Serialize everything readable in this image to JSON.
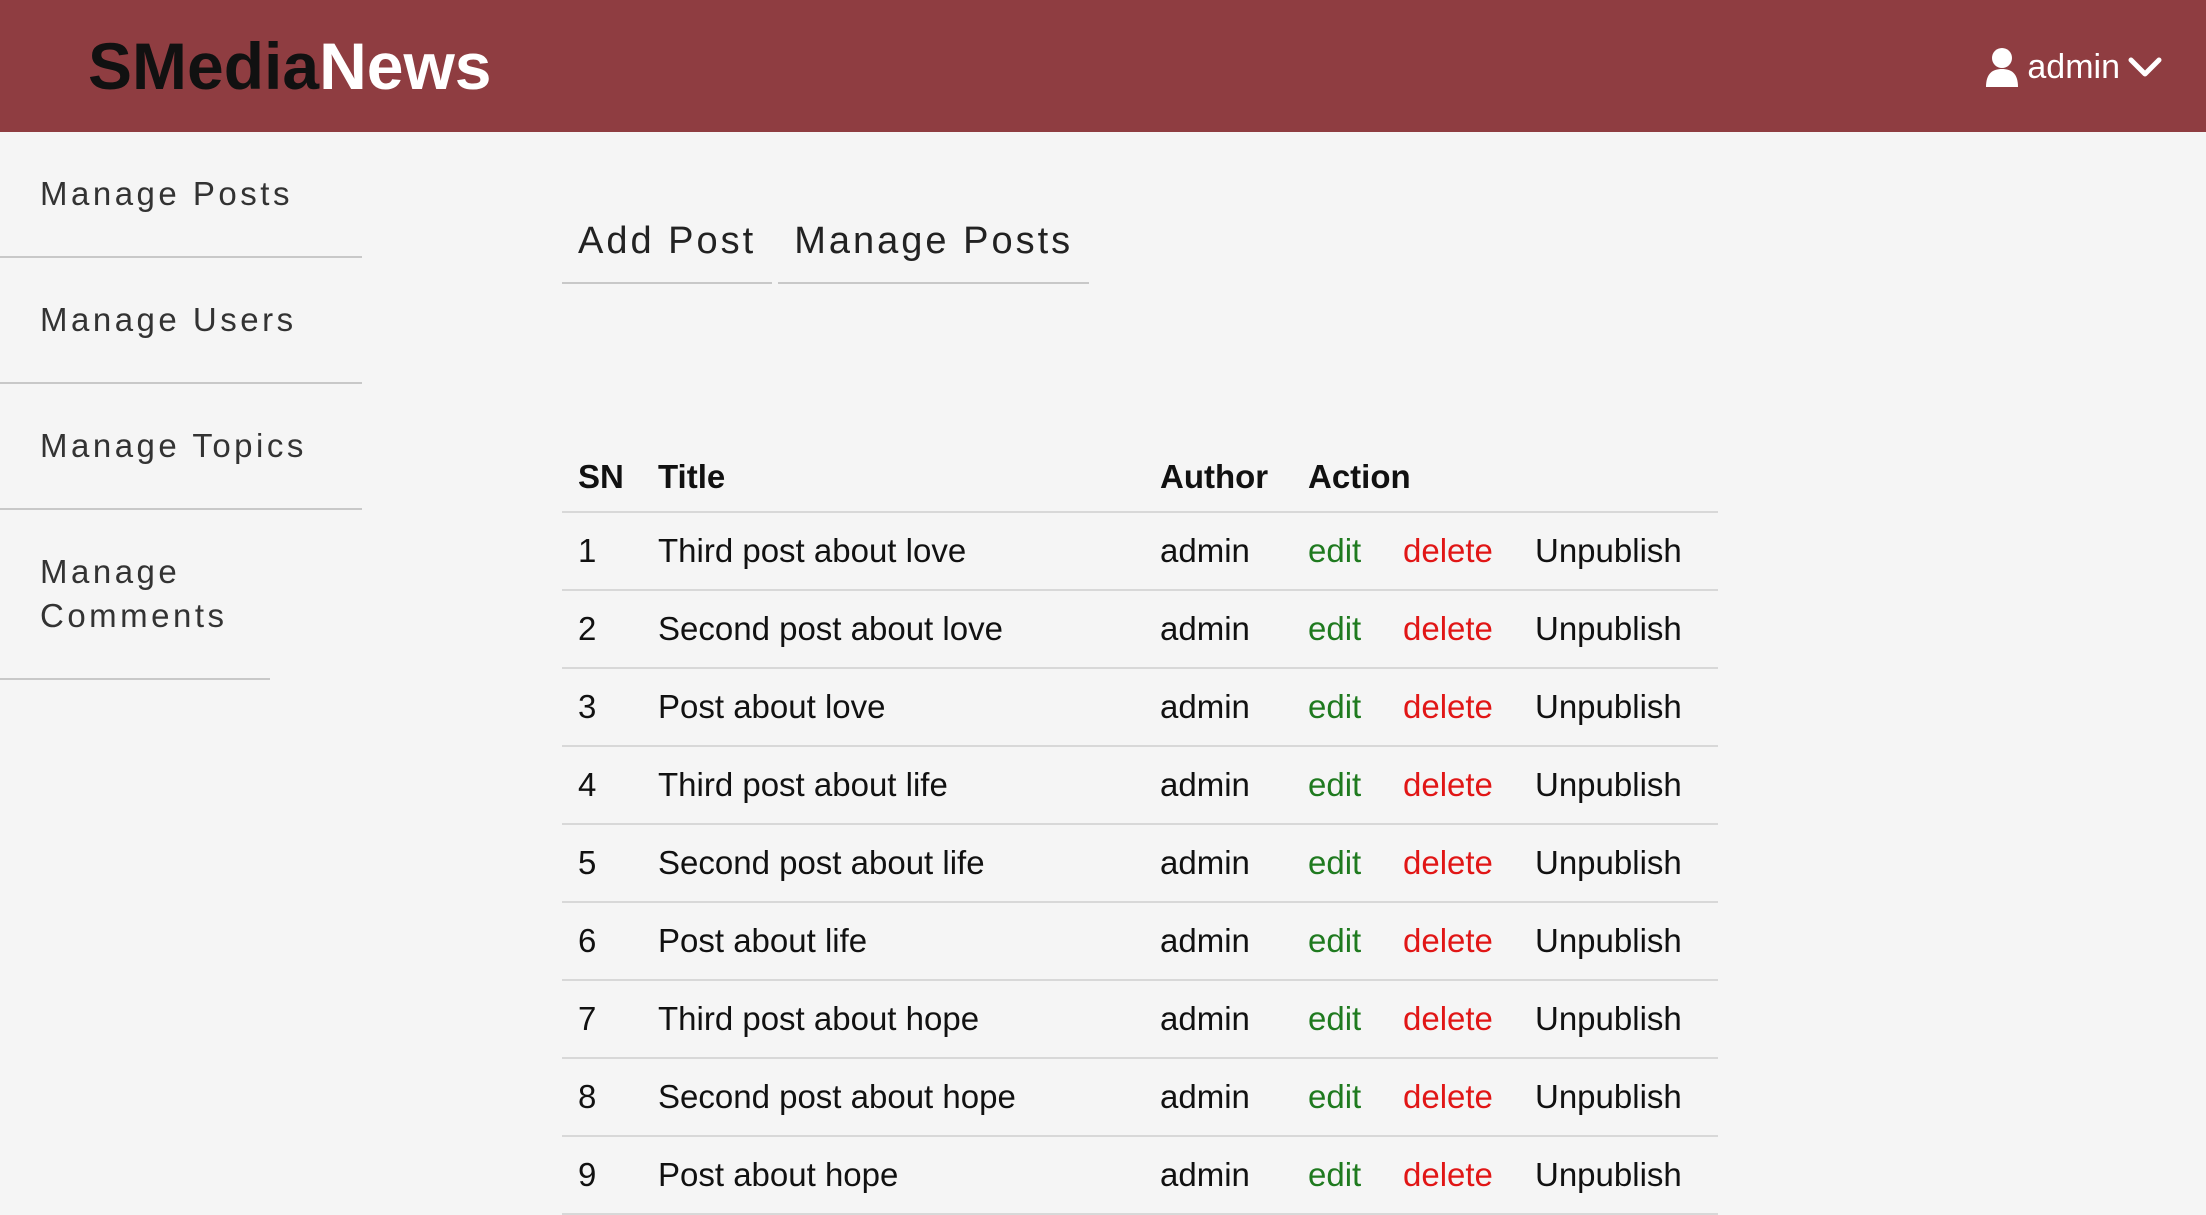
{
  "brand": {
    "part1": "SMedia",
    "part2": "News"
  },
  "user": {
    "name": "admin",
    "icon": "user-icon",
    "dropdown_icon": "chevron-down-icon"
  },
  "sidebar": {
    "items": [
      {
        "label": "Manage Posts"
      },
      {
        "label": "Manage Users"
      },
      {
        "label": "Manage Topics"
      },
      {
        "label": "Manage Comments"
      }
    ]
  },
  "tabs": [
    {
      "label": "Add Post"
    },
    {
      "label": "Manage Posts"
    }
  ],
  "table": {
    "headers": {
      "sn": "SN",
      "title": "Title",
      "author": "Author",
      "action": "Action"
    },
    "rows": [
      {
        "sn": "1",
        "title": "Third post about love",
        "author": "admin",
        "edit": "edit",
        "delete": "delete",
        "publish": "Unpublish"
      },
      {
        "sn": "2",
        "title": "Second post about love",
        "author": "admin",
        "edit": "edit",
        "delete": "delete",
        "publish": "Unpublish"
      },
      {
        "sn": "3",
        "title": "Post about love",
        "author": "admin",
        "edit": "edit",
        "delete": "delete",
        "publish": "Unpublish"
      },
      {
        "sn": "4",
        "title": "Third post about life",
        "author": "admin",
        "edit": "edit",
        "delete": "delete",
        "publish": "Unpublish"
      },
      {
        "sn": "5",
        "title": "Second post about life",
        "author": "admin",
        "edit": "edit",
        "delete": "delete",
        "publish": "Unpublish"
      },
      {
        "sn": "6",
        "title": "Post about life",
        "author": "admin",
        "edit": "edit",
        "delete": "delete",
        "publish": "Unpublish"
      },
      {
        "sn": "7",
        "title": "Third post about hope",
        "author": "admin",
        "edit": "edit",
        "delete": "delete",
        "publish": "Unpublish"
      },
      {
        "sn": "8",
        "title": "Second post about hope",
        "author": "admin",
        "edit": "edit",
        "delete": "delete",
        "publish": "Unpublish"
      },
      {
        "sn": "9",
        "title": "Post about hope",
        "author": "admin",
        "edit": "edit",
        "delete": "delete",
        "publish": "Unpublish"
      }
    ]
  },
  "colors": {
    "header_bg": "#8f3d41",
    "edit": "#1f7a1f",
    "delete": "#e11616",
    "page_bg": "#f5f5f5"
  }
}
